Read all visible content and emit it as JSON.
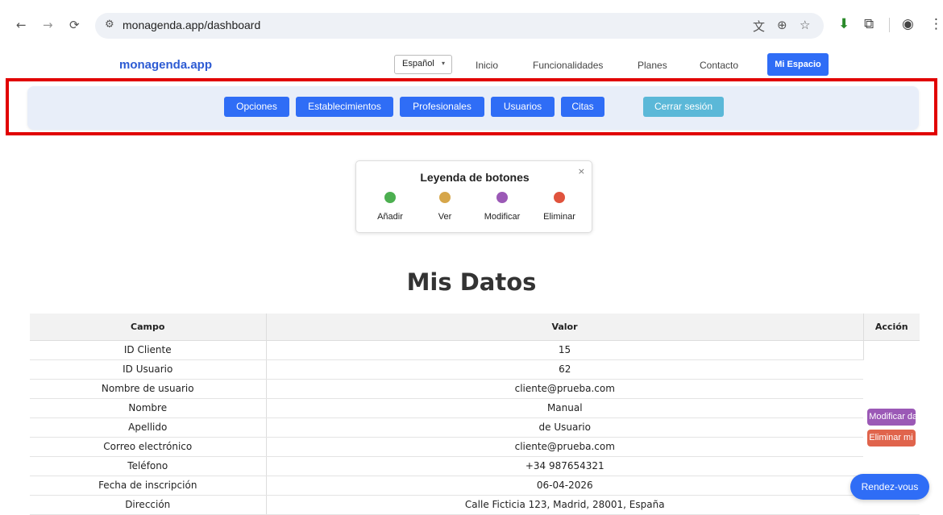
{
  "browser": {
    "url": "monagenda.app/dashboard"
  },
  "header": {
    "logo": "monagenda.app",
    "language": "Español",
    "nav": [
      "Inicio",
      "Funcionalidades",
      "Planes",
      "Contacto"
    ],
    "my_space": "Mi Espacio"
  },
  "toolbar": {
    "buttons": [
      "Opciones",
      "Establecimientos",
      "Profesionales",
      "Usuarios",
      "Citas",
      "Cerrar sesión"
    ]
  },
  "legend": {
    "title": "Leyenda de botones",
    "close": "×",
    "items": [
      {
        "label": "Añadir",
        "color": "#4caf50"
      },
      {
        "label": "Ver",
        "color": "#d6a64a"
      },
      {
        "label": "Modificar",
        "color": "#9b59b6"
      },
      {
        "label": "Eliminar",
        "color": "#e0533d"
      }
    ]
  },
  "main": {
    "title": "Mis Datos",
    "columns": [
      "Campo",
      "Valor",
      "Acción"
    ],
    "rows": [
      {
        "field": "ID Cliente",
        "value": "15"
      },
      {
        "field": "ID Usuario",
        "value": "62"
      },
      {
        "field": "Nombre de usuario",
        "value": "cliente@prueba.com"
      },
      {
        "field": "Nombre",
        "value": "Manual"
      },
      {
        "field": "Apellido",
        "value": "de Usuario"
      },
      {
        "field": "Correo electrónico",
        "value": "cliente@prueba.com"
      },
      {
        "field": "Teléfono",
        "value": "+34 987654321"
      },
      {
        "field": "Fecha de inscripción",
        "value": "06-04-2026"
      },
      {
        "field": "Dirección",
        "value": "Calle Ficticia 123, Madrid, 28001, España"
      }
    ],
    "actions": {
      "modify": "Modificar datos",
      "delete": "Eliminar mi perfil"
    }
  },
  "chat_button": "Rendez-vous",
  "colors": {
    "primary": "#2f6df6",
    "info": "#5bb8d8",
    "highlight": "#e10000"
  }
}
